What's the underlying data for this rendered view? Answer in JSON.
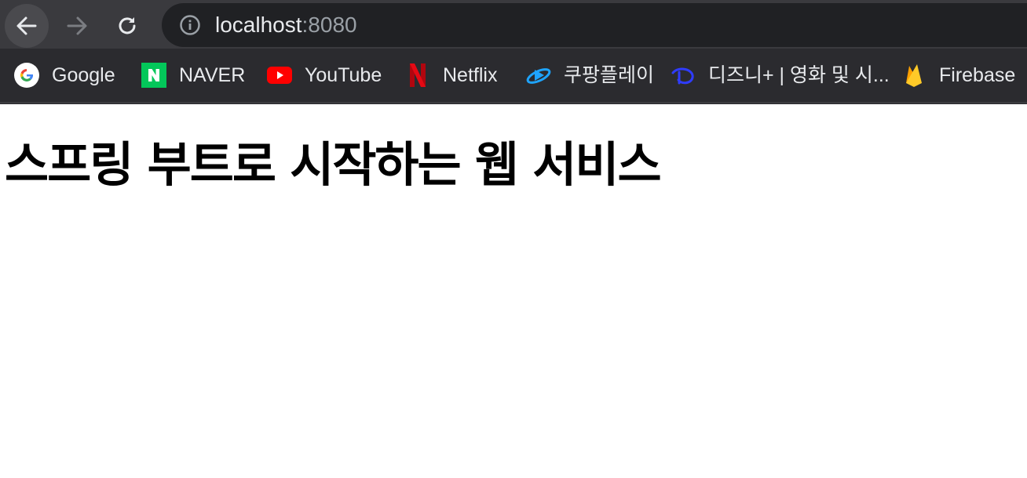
{
  "address_bar": {
    "host": "localhost",
    "port": ":8080"
  },
  "bookmarks": [
    {
      "label": "Google",
      "icon": "google-icon"
    },
    {
      "label": "NAVER",
      "icon": "naver-icon"
    },
    {
      "label": "YouTube",
      "icon": "youtube-icon"
    },
    {
      "label": "Netflix",
      "icon": "netflix-icon"
    },
    {
      "label": "쿠팡플레이",
      "icon": "coupang-play-icon"
    },
    {
      "label": "디즈니+ | 영화 및 시...",
      "icon": "disney-plus-icon"
    },
    {
      "label": "Firebase",
      "icon": "firebase-icon"
    }
  ],
  "page": {
    "title": "스프링 부트로 시작하는 웹 서비스"
  },
  "colors": {
    "toolbar": "#3a3a3e",
    "bookmarks_bar": "#2b2b2f",
    "omnibox": "#202124",
    "page_background": "#ffffff",
    "title_text": "#000000"
  }
}
